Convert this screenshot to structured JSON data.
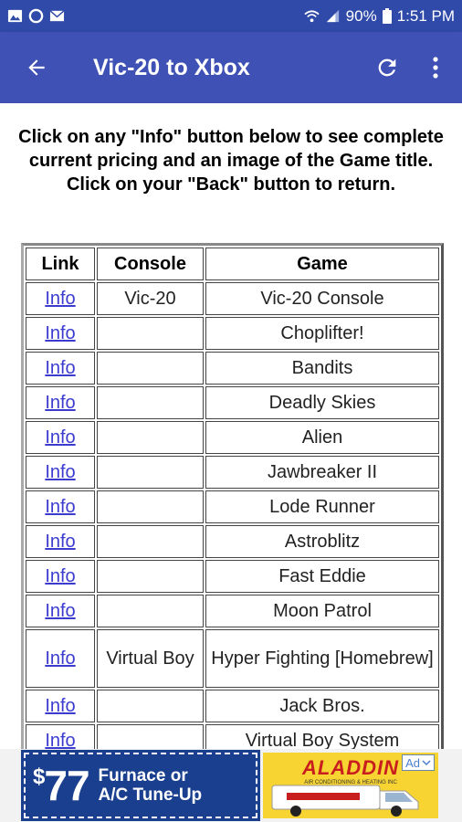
{
  "status_bar": {
    "battery": "90%",
    "time": "1:51 PM",
    "left_icons": [
      "image-icon",
      "circle-icon",
      "mail-icon"
    ]
  },
  "app_bar": {
    "title": "Vic-20 to Xbox"
  },
  "intro_text": "Click on any \"Info\" button below to see complete current pricing and an image of the Game title. Click on your \"Back\" button to return.",
  "table": {
    "headers": [
      "Link",
      "Console",
      "Game"
    ],
    "rows": [
      {
        "link": "Info",
        "console": "Vic-20",
        "game": "Vic-20 Console"
      },
      {
        "link": "Info",
        "console": "",
        "game": "Choplifter!"
      },
      {
        "link": "Info",
        "console": "",
        "game": "Bandits"
      },
      {
        "link": "Info",
        "console": "",
        "game": "Deadly Skies"
      },
      {
        "link": "Info",
        "console": "",
        "game": "Alien"
      },
      {
        "link": "Info",
        "console": "",
        "game": "Jawbreaker II"
      },
      {
        "link": "Info",
        "console": "",
        "game": "Lode Runner"
      },
      {
        "link": "Info",
        "console": "",
        "game": "Astroblitz"
      },
      {
        "link": "Info",
        "console": "",
        "game": "Fast Eddie"
      },
      {
        "link": "Info",
        "console": "",
        "game": "Moon Patrol"
      },
      {
        "link": "Info",
        "console": "Virtual Boy",
        "game": "Hyper Fighting [Homebrew]"
      },
      {
        "link": "Info",
        "console": "",
        "game": "Jack Bros."
      },
      {
        "link": "Info",
        "console": "",
        "game": "Virtual Boy System"
      }
    ]
  },
  "ad": {
    "price_symbol": "$",
    "price": "77",
    "line1": "Furnace or",
    "line2": "A/C Tune-Up",
    "brand": "ALADDIN",
    "brand_sub": "AIR CONDITIONING & HEATING INC",
    "badge": "Ad"
  },
  "colors": {
    "status_bar": "#2f4aa8",
    "app_bar": "#3f51b5",
    "link": "#3b3bd0",
    "ad_blue": "#1a3f8f",
    "ad_yellow": "#f7d431"
  }
}
